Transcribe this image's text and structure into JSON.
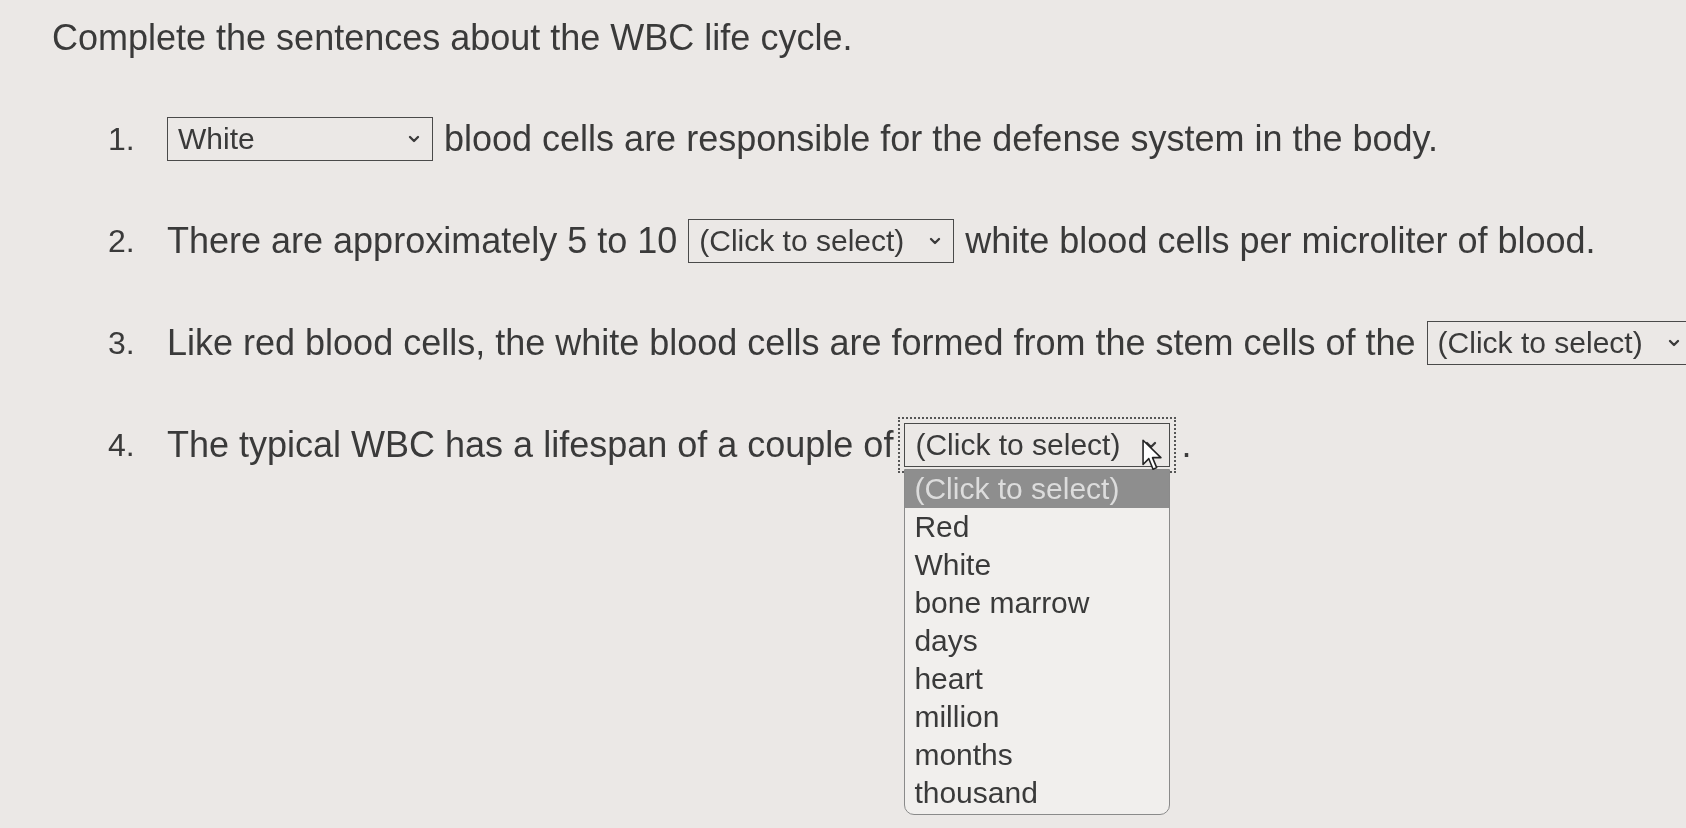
{
  "instructions": "Complete the sentences about the WBC life cycle.",
  "questions": [
    {
      "number": "1.",
      "parts": [
        {
          "kind": "dropdown",
          "value": "White",
          "open": false
        },
        {
          "kind": "text",
          "text": "blood cells are responsible for the defense system in the body."
        }
      ]
    },
    {
      "number": "2.",
      "parts": [
        {
          "kind": "text",
          "text": "There are approximately 5 to 10"
        },
        {
          "kind": "dropdown",
          "value": "(Click to select)",
          "open": false
        },
        {
          "kind": "text",
          "text": "white blood cells per microliter of blood."
        }
      ]
    },
    {
      "number": "3.",
      "parts": [
        {
          "kind": "text",
          "text": "Like red blood cells, the white blood cells are formed from the stem cells of the"
        },
        {
          "kind": "dropdown",
          "value": "(Click to select)",
          "open": false
        }
      ]
    },
    {
      "number": "4.",
      "parts": [
        {
          "kind": "text",
          "text": "The typical WBC has a lifespan of a couple of"
        },
        {
          "kind": "dropdown",
          "value": "(Click to select)",
          "open": true,
          "options": [
            {
              "label": "(Click to select)",
              "selected": true
            },
            {
              "label": "Red",
              "selected": false
            },
            {
              "label": "White",
              "selected": false
            },
            {
              "label": "bone marrow",
              "selected": false
            },
            {
              "label": "days",
              "selected": false
            },
            {
              "label": "heart",
              "selected": false
            },
            {
              "label": "million",
              "selected": false
            },
            {
              "label": "months",
              "selected": false
            },
            {
              "label": "thousand",
              "selected": false
            }
          ]
        },
        {
          "kind": "text",
          "text": "."
        }
      ]
    }
  ]
}
